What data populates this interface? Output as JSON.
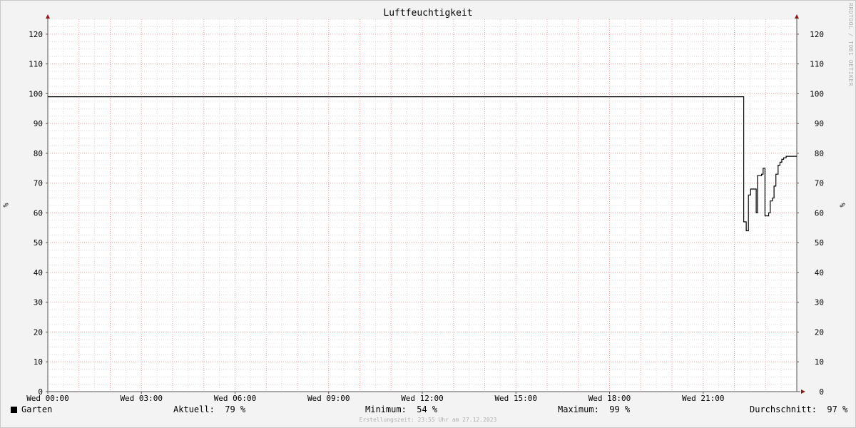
{
  "chart_data": {
    "type": "line",
    "title": "Luftfeuchtigkeit",
    "ylabel": "%",
    "ylabel_right": "%",
    "watermark": "RRDTOOL / TOBI OETIKER",
    "ylim": [
      0,
      125
    ],
    "y_ticks": [
      0,
      10,
      20,
      30,
      40,
      50,
      60,
      70,
      80,
      90,
      100,
      110,
      120
    ],
    "x_range_hours": [
      0,
      24
    ],
    "x_ticks": [
      {
        "hour": 0,
        "label": "Wed 00:00"
      },
      {
        "hour": 3,
        "label": "Wed 03:00"
      },
      {
        "hour": 6,
        "label": "Wed 06:00"
      },
      {
        "hour": 9,
        "label": "Wed 09:00"
      },
      {
        "hour": 12,
        "label": "Wed 12:00"
      },
      {
        "hour": 15,
        "label": "Wed 15:00"
      },
      {
        "hour": 18,
        "label": "Wed 18:00"
      },
      {
        "hour": 21,
        "label": "Wed 21:00"
      }
    ],
    "grid": true,
    "series": [
      {
        "name": "Garten",
        "color": "#000000",
        "points": [
          [
            0,
            99
          ],
          [
            22.3,
            99
          ],
          [
            22.3,
            57
          ],
          [
            22.38,
            57
          ],
          [
            22.38,
            54
          ],
          [
            22.45,
            54
          ],
          [
            22.45,
            66
          ],
          [
            22.52,
            66
          ],
          [
            22.52,
            68
          ],
          [
            22.7,
            68
          ],
          [
            22.7,
            60
          ],
          [
            22.74,
            60
          ],
          [
            22.74,
            72.5
          ],
          [
            22.87,
            72.5
          ],
          [
            22.87,
            73
          ],
          [
            22.92,
            73
          ],
          [
            22.92,
            75
          ],
          [
            22.98,
            75
          ],
          [
            22.98,
            59
          ],
          [
            23.1,
            59
          ],
          [
            23.1,
            60
          ],
          [
            23.15,
            60
          ],
          [
            23.15,
            64
          ],
          [
            23.22,
            64
          ],
          [
            23.22,
            65
          ],
          [
            23.27,
            65
          ],
          [
            23.27,
            69
          ],
          [
            23.33,
            69
          ],
          [
            23.33,
            73
          ],
          [
            23.4,
            73
          ],
          [
            23.4,
            76
          ],
          [
            23.46,
            76
          ],
          [
            23.46,
            77
          ],
          [
            23.52,
            77
          ],
          [
            23.52,
            78
          ],
          [
            23.58,
            78
          ],
          [
            23.58,
            78.5
          ],
          [
            23.66,
            78.5
          ],
          [
            23.66,
            79
          ],
          [
            24,
            79
          ]
        ]
      }
    ]
  },
  "legend": {
    "series_name": "Garten",
    "current": "Aktuell:  79 %",
    "minimum": "Minimum:  54 %",
    "maximum": "Maximum:  99 %",
    "average": "Durchschnitt:  97 %"
  },
  "footer": "Erstellungszeit: 23:55 Uhr am 27.12.2023"
}
